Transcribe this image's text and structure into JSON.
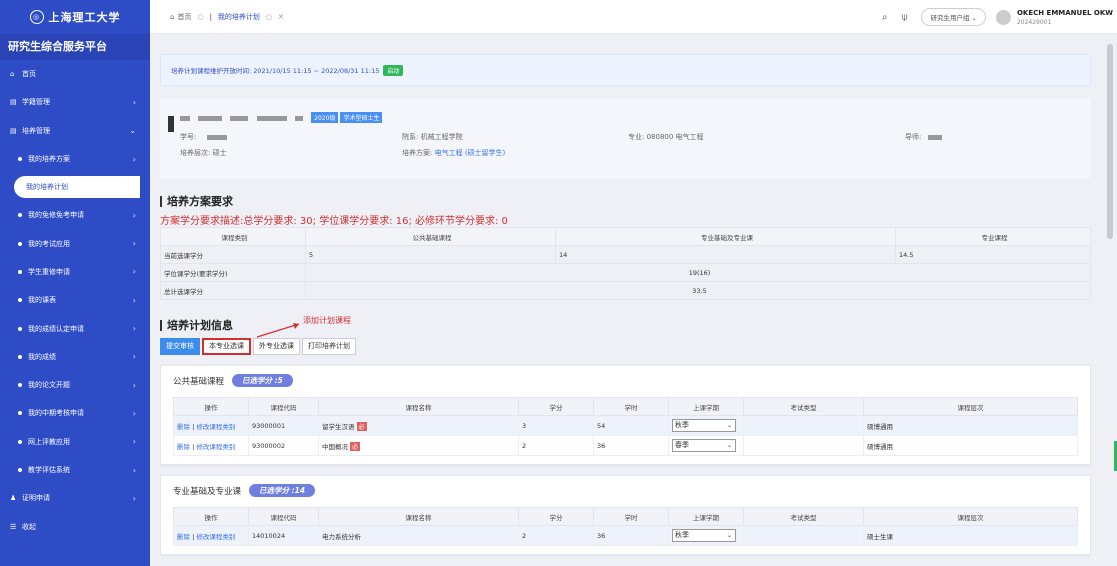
{
  "sidebar": {
    "logo": "上海理工大学",
    "platform": "研究生综合服务平台",
    "items": [
      {
        "label": "首页",
        "type": "top",
        "icon": "home-icon"
      },
      {
        "label": "学籍管理",
        "type": "top",
        "icon": "grid-icon",
        "arrow": "›"
      },
      {
        "label": "培养管理",
        "type": "top",
        "icon": "grid-icon",
        "arrow": "⌄"
      },
      {
        "label": "我的培养方案",
        "type": "sub",
        "arrow": "›"
      },
      {
        "label": "我的培养计划",
        "type": "active"
      },
      {
        "label": "我的免修免考申请",
        "type": "sub",
        "arrow": "›"
      },
      {
        "label": "我的考试应用",
        "type": "sub",
        "arrow": "›"
      },
      {
        "label": "学生重修申请",
        "type": "sub",
        "arrow": "›"
      },
      {
        "label": "我的课表",
        "type": "sub",
        "arrow": "›"
      },
      {
        "label": "我的成绩认定申请",
        "type": "sub",
        "arrow": "›"
      },
      {
        "label": "我的成绩",
        "type": "sub",
        "arrow": "›"
      },
      {
        "label": "我的论文开题",
        "type": "sub",
        "arrow": "›"
      },
      {
        "label": "我的中期考核申请",
        "type": "sub",
        "arrow": "›"
      },
      {
        "label": "网上评教应用",
        "type": "sub",
        "arrow": "›"
      },
      {
        "label": "教学评估系统",
        "type": "sub",
        "arrow": "›"
      },
      {
        "label": "证明申请",
        "type": "top",
        "icon": "user-icon",
        "arrow": "›"
      },
      {
        "label": "收起",
        "type": "top",
        "icon": "collapse-icon"
      }
    ]
  },
  "header": {
    "tabs": [
      {
        "label": "首页"
      },
      {
        "label": "我的培养计划"
      }
    ],
    "role": "研究生用户组",
    "user_name": "OKECH EMMANUEL OKW",
    "user_id": "202429001"
  },
  "notice": {
    "text": "培养计划课程维护开放时间: 2021/10/15 11:15 ~ 2022/08/31 11:15",
    "status": "启动"
  },
  "student": {
    "tags": [
      "2020级",
      "学术型硕士生"
    ],
    "id_label": "学号:",
    "level_label": "培养层次:",
    "level_value": "硕士",
    "college_label": "院系:",
    "college_value": "机械工程学院",
    "plan_label": "培养方案:",
    "plan_value": "电气工程 (硕士留学生)",
    "major_label": "专业:",
    "major_value": "080800 电气工程",
    "advisor_label": "导师:"
  },
  "requirements": {
    "title": "培养方案要求",
    "desc": "方案学分要求描述:总学分要求: 30; 学位课学分要求: 16; 必修环节学分要求: 0",
    "headers": [
      "课程类别",
      "公共基础课程",
      "专业基础及专业课",
      "专业课程"
    ],
    "rows": [
      [
        "当前选课学分",
        "5",
        "14",
        "14.5"
      ],
      [
        "学位课学分(要求学分)",
        "19(16)"
      ],
      [
        "总计选课学分",
        "33.5"
      ]
    ]
  },
  "plan": {
    "title": "培养计划信息",
    "buttons": [
      "提交审核",
      "本专业选课",
      "外专业选课",
      "打印培养计划"
    ],
    "annotation": "添加计划课程"
  },
  "course_headers": [
    "操作",
    "课程代码",
    "课程名称",
    "学分",
    "学时",
    "上课学期",
    "考试类型",
    "课程层次"
  ],
  "sections": [
    {
      "title": "公共基础课程",
      "credit": "已选学分 :5",
      "rows": [
        {
          "op1": "删除",
          "op2": "修改课程类别",
          "code": "93000001",
          "name": "留学生汉语",
          "mark": "必",
          "credit": "3",
          "hours": "54",
          "term": "秋季",
          "exam": "",
          "level": "硕博通用"
        },
        {
          "op1": "删除",
          "op2": "修改课程类别",
          "code": "93000002",
          "name": "中国概况",
          "mark": "必",
          "credit": "2",
          "hours": "36",
          "term": "春季",
          "exam": "",
          "level": "硕博通用"
        }
      ]
    },
    {
      "title": "专业基础及专业课",
      "credit": "已选学分 :14",
      "rows": [
        {
          "op1": "删除",
          "op2": "修改课程类别",
          "code": "14010024",
          "name": "电力系统分析",
          "mark": "",
          "credit": "2",
          "hours": "36",
          "term": "秋季",
          "exam": "",
          "level": "硕士生课"
        }
      ]
    }
  ]
}
